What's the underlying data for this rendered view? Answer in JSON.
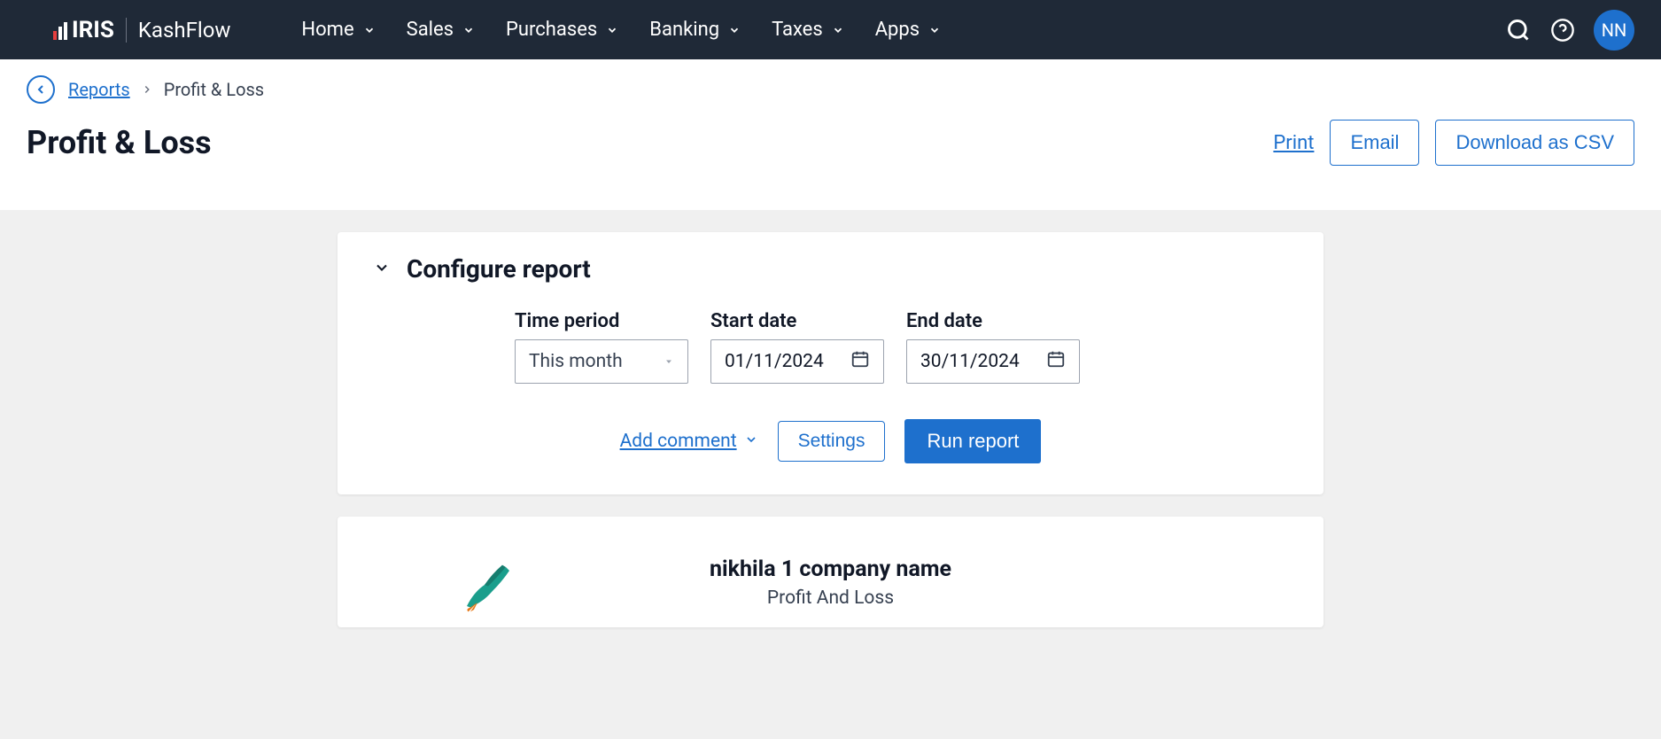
{
  "brand": {
    "main": "IRIS",
    "sub": "KashFlow"
  },
  "nav": {
    "items": [
      {
        "label": "Home"
      },
      {
        "label": "Sales"
      },
      {
        "label": "Purchases"
      },
      {
        "label": "Banking"
      },
      {
        "label": "Taxes"
      },
      {
        "label": "Apps"
      }
    ]
  },
  "avatar": "NN",
  "breadcrumb": {
    "link": "Reports",
    "current": "Profit & Loss"
  },
  "page": {
    "title": "Profit & Loss"
  },
  "actions": {
    "print": "Print",
    "email": "Email",
    "csv": "Download as CSV"
  },
  "configure": {
    "title": "Configure report",
    "time_period": {
      "label": "Time period",
      "value": "This month"
    },
    "start_date": {
      "label": "Start date",
      "value": "01/11/2024"
    },
    "end_date": {
      "label": "End date",
      "value": "30/11/2024"
    },
    "add_comment": "Add comment",
    "settings": "Settings",
    "run": "Run report"
  },
  "report": {
    "company": "nikhila 1 company name",
    "name": "Profit And Loss"
  }
}
